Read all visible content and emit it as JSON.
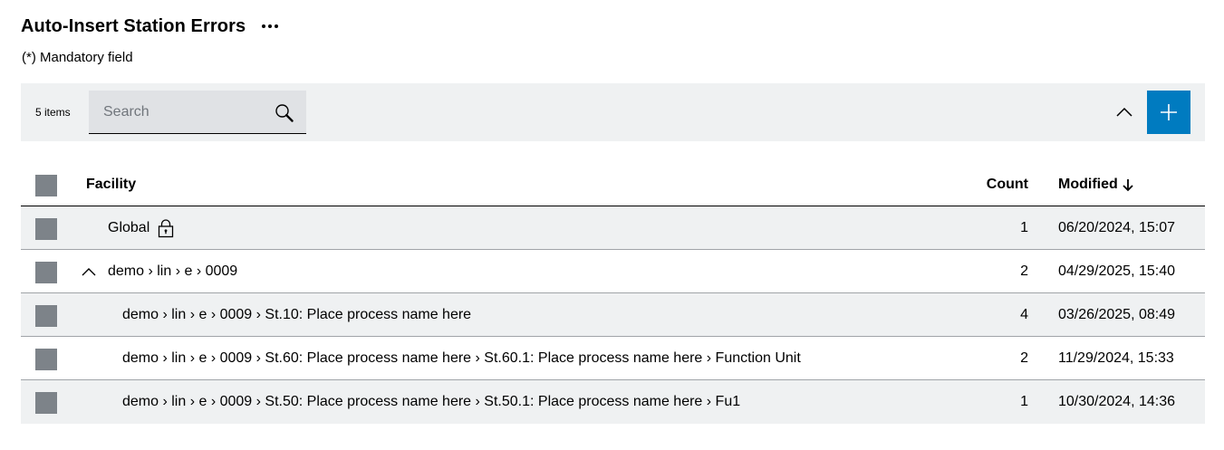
{
  "page": {
    "title": "Auto-Insert Station Errors",
    "mandatory_note": "(*) Mandatory field"
  },
  "toolbar": {
    "item_count": "5 items",
    "search_placeholder": "Search",
    "search_value": "",
    "accent_color": "#007bc0"
  },
  "table": {
    "columns": {
      "facility": "Facility",
      "count": "Count",
      "modified": "Modified"
    },
    "sort": {
      "column": "Modified",
      "direction": "descending"
    },
    "rows": [
      {
        "facility": "Global",
        "count": "1",
        "modified": "06/20/2024, 15:07",
        "locked": true
      },
      {
        "facility": "demo › lin › e › 0009",
        "count": "2",
        "modified": "04/29/2025, 15:40",
        "expanded": true
      },
      {
        "facility": "demo › lin › e › 0009 › St.10: Place process name here",
        "count": "4",
        "modified": "03/26/2025, 08:49"
      },
      {
        "facility": "demo › lin › e › 0009 › St.60: Place process name here › St.60.1: Place process name here › Function Unit",
        "count": "2",
        "modified": "11/29/2024, 15:33"
      },
      {
        "facility": "demo › lin › e › 0009 › St.50: Place process name here › St.50.1: Place process name here › Fu1",
        "count": "1",
        "modified": "10/30/2024, 14:36"
      }
    ]
  }
}
